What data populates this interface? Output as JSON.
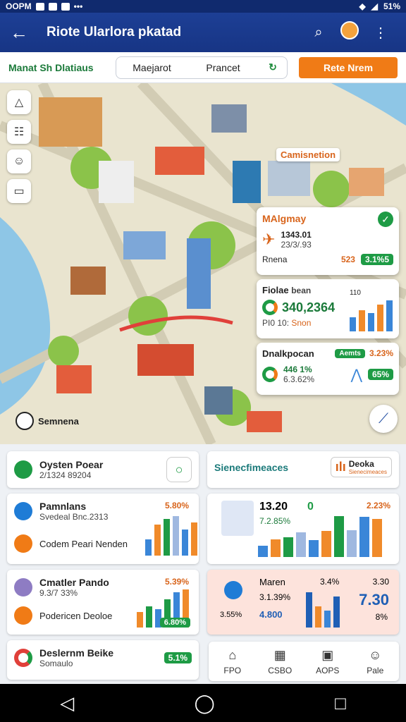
{
  "status_bar": {
    "left_text": "OOPM",
    "right_text": "51%"
  },
  "app_bar": {
    "title": "Riote Ularlora pkatad"
  },
  "filter": {
    "label": "Manat Sh Dlatiaus",
    "segments": [
      "Maejarot",
      "Prancet"
    ],
    "segment_icon": "↻",
    "cta": "Rete Nrem"
  },
  "map": {
    "label_orange": "Camisnetion",
    "place_label": "Semnena",
    "card1": {
      "title": "MAlgmay",
      "value": "1343.01",
      "sub": "23/3/.93",
      "row_label": "Rnena",
      "pill": "3.1%5",
      "mid": "523"
    },
    "card2": {
      "title": "Fiolae",
      "title2": "bean",
      "big": "340,2364",
      "sub": "PI0 10:",
      "sub2": "Snon",
      "tick": "110"
    },
    "card3": {
      "title": "Dnalkpocan",
      "pill_top": "Aemts",
      "pct": "3.23%",
      "val": "446",
      "val2": "1%",
      "sub": "6.3.62%",
      "pill": "65%"
    }
  },
  "colors": {
    "brand": "#1d3f95",
    "accent": "#f07b16",
    "success": "#1e9b45"
  },
  "panels": {
    "system": {
      "title": "Oysten Poear",
      "sub": "2/1324 89204"
    },
    "sentiment": {
      "title": "Sienecfimeaces",
      "badge": "Deoka",
      "badge_sub": "Sienecimeaces"
    },
    "params": {
      "title": "Pamnlans",
      "sub": "Svedeal Bnc.2313",
      "pct": "5.80%",
      "row2": "Codem Peari Nenden"
    },
    "chart_mid": {
      "label": "13.20",
      "sub": "7.2.85%",
      "pct": "2.23%",
      "mark": "0"
    },
    "cmatler": {
      "title": "Cmatler Pando",
      "sub": "9.3/7 33%",
      "pct": "5.39%",
      "pill": "6.80%",
      "row2": "Podericen Deoloe"
    },
    "mean": {
      "title": "Maren",
      "pct": "3.4%",
      "val": "3.30",
      "sub": "3.1.39%",
      "pill": "4.800",
      "sub2": "3.55%",
      "big": "7.30",
      "small": "8%"
    },
    "deserum": {
      "title": "Deslernm Beike",
      "sub": "Somaulo",
      "pill": "5.1%"
    }
  },
  "nav": [
    {
      "label": "FPO",
      "icon": "home-icon",
      "glyph": "⌂"
    },
    {
      "label": "CSBO",
      "icon": "grid-icon",
      "glyph": "▦"
    },
    {
      "label": "AOPS",
      "icon": "doc-icon",
      "glyph": "▣"
    },
    {
      "label": "Pale",
      "icon": "person-icon",
      "glyph": "☺"
    }
  ],
  "chart_data": [
    {
      "type": "bar",
      "categories": [
        "1",
        "2",
        "3",
        "4",
        "5",
        "6"
      ],
      "values": [
        38,
        72,
        86,
        92,
        60,
        78
      ],
      "title": "",
      "xlabel": "",
      "ylabel": ""
    },
    {
      "type": "bar",
      "categories": [
        "1",
        "2",
        "3",
        "4",
        "5",
        "6",
        "7",
        "8",
        "9",
        "10"
      ],
      "values": [
        22,
        36,
        40,
        50,
        34,
        52,
        82,
        54,
        80,
        76
      ],
      "title": "",
      "xlabel": "",
      "ylabel": ""
    }
  ]
}
